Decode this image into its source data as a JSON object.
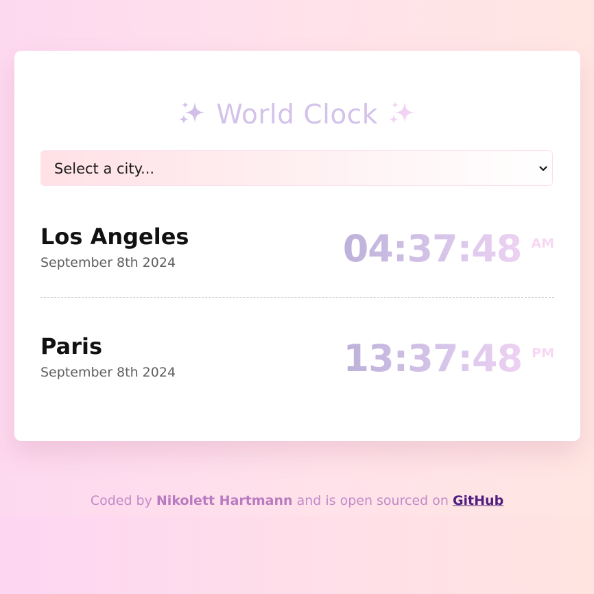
{
  "header": {
    "title": "World Clock",
    "sparkle_icon": "sparkles-icon"
  },
  "city_select": {
    "selected": "Select a city..."
  },
  "cities": [
    {
      "name": "Los Angeles",
      "date": "September 8th 2024",
      "time": "04:37:48",
      "ampm": "AM"
    },
    {
      "name": "Paris",
      "date": "September 8th 2024",
      "time": "13:37:48",
      "ampm": "PM"
    }
  ],
  "footer": {
    "prefix": "Coded by",
    "author": "Nikolett Hartmann",
    "middle": "and is open sourced on",
    "link": "GitHub"
  },
  "colors": {
    "title": "#d3c2ea",
    "time_start": "#bdb1d9",
    "time_end": "#f7d7f6",
    "footer_text": "#c18bc8",
    "link": "#4e1f7f"
  }
}
